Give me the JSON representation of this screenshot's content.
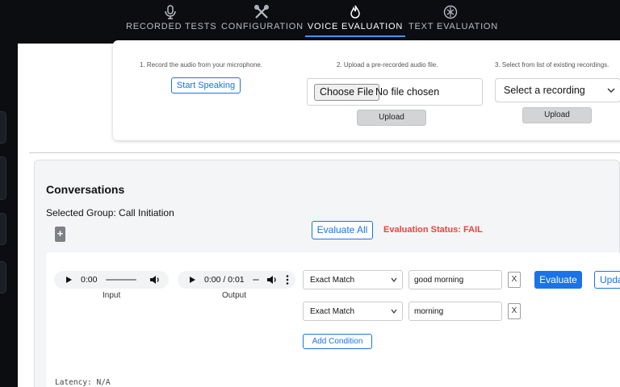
{
  "nav": {
    "tabs": [
      {
        "label": "RECORDED TESTS",
        "icon": "microphone-icon",
        "active": false
      },
      {
        "label": "CONFIGURATION",
        "icon": "tools-icon",
        "active": false
      },
      {
        "label": "VOICE EVALUATION",
        "icon": "flame-icon",
        "active": true
      },
      {
        "label": "TEXT EVALUATION",
        "icon": "chatgpt-logo-icon",
        "active": false
      }
    ],
    "accent": "#4f8ff7"
  },
  "upload": {
    "step1": "1. Record the audio from your microphone.",
    "step2": "2. Upload a pre-recorded audio file.",
    "step3": "3. Select from list of existing recordings.",
    "start_speaking": "Start Speaking",
    "choose_file": "Choose File",
    "no_file": "No file chosen",
    "upload": "Upload",
    "select_recording": "Select a recording"
  },
  "conversations": {
    "title": "Conversations",
    "selected_group": "Selected Group: Call Initiation",
    "plus": "+",
    "evaluate_all": "Evaluate All",
    "evaluation_status": "Evaluation Status: FAIL",
    "status_color": "#e8453c",
    "row": {
      "input_audio": {
        "time": "0:00",
        "caption": "Input"
      },
      "output_audio": {
        "time": "0:00 / 0:01",
        "caption": "Output"
      },
      "conditions": [
        {
          "match": "Exact Match",
          "value": "good morning",
          "remove": "X"
        },
        {
          "match": "Exact Match",
          "value": "morning",
          "remove": "X"
        }
      ],
      "evaluate": "Evaluate",
      "update": "Update",
      "add_condition": "Add Condition",
      "latency": "Latency: N/A"
    }
  }
}
